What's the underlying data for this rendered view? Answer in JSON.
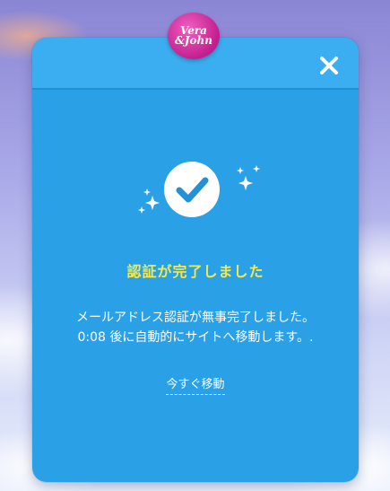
{
  "brand": {
    "logo_line1": "Vera",
    "logo_line2": "&John",
    "accent": "#c21e8f"
  },
  "modal": {
    "close_icon": "close-icon",
    "success_icon": "checkmark-icon",
    "title": "認証が完了しました",
    "message_line1": "メールアドレス認証が無事完了しました。",
    "message_line2": "0:08 後に自動的にサイトへ移動します。.",
    "move_now_label": "今すぐ移動",
    "background": "#2aa1e6",
    "title_color": "#f5e94a"
  }
}
